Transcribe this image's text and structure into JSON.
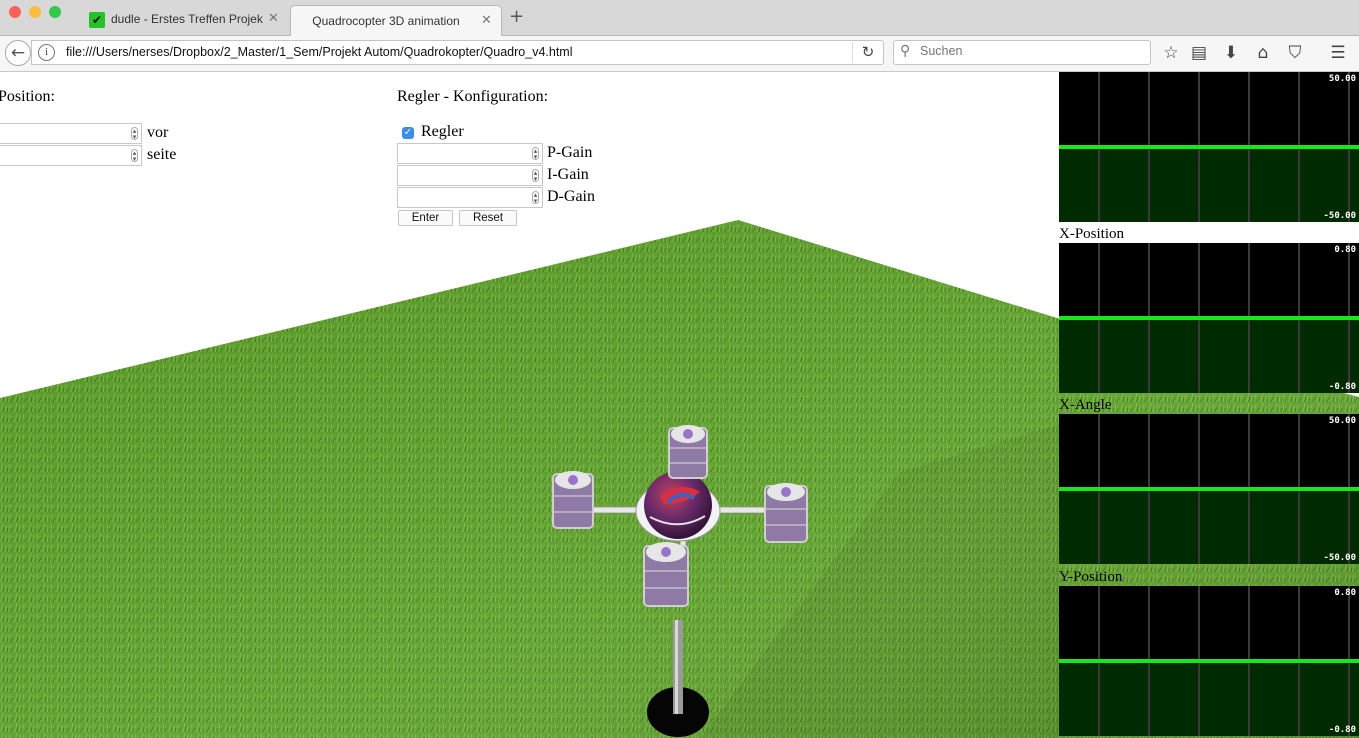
{
  "browser": {
    "tabs": [
      {
        "title": "dudle - Erstes Treffen Projekt",
        "active": false
      },
      {
        "title": "Quadrocopter 3D animation",
        "active": true
      }
    ],
    "url": "file:///Users/nerses/Dropbox/2_Master/1_Sem/Projekt Autom/Quadrokopter/Quadro_v4.html",
    "search_placeholder": "Suchen"
  },
  "position_panel": {
    "heading": "Position:",
    "fields": [
      {
        "label": "vor",
        "value": ""
      },
      {
        "label": "seite",
        "value": ""
      }
    ]
  },
  "controller_panel": {
    "heading": "Regler - Konfiguration:",
    "checkbox_label": "Regler",
    "checkbox_checked": true,
    "fields": [
      {
        "label": "P-Gain",
        "value": ""
      },
      {
        "label": "I-Gain",
        "value": ""
      },
      {
        "label": "D-Gain",
        "value": ""
      }
    ],
    "enter_label": "Enter",
    "reset_label": "Reset"
  },
  "graphs": [
    {
      "caption": "",
      "max_label": "50.00",
      "min_label": "-50.00",
      "value": 0
    },
    {
      "caption": "X-Position",
      "max_label": "0.80",
      "min_label": "-0.80",
      "value": 0
    },
    {
      "caption": "X-Angle",
      "max_label": "50.00",
      "min_label": "-50.00",
      "value": 0
    },
    {
      "caption": "Y-Position",
      "max_label": "0.80",
      "min_label": "-0.80",
      "value": 0
    }
  ],
  "colors": {
    "graph_background": "#000000",
    "graph_lower_fill": "#002a00",
    "graph_line": "#18e818",
    "grass": "#5c9e2a"
  }
}
